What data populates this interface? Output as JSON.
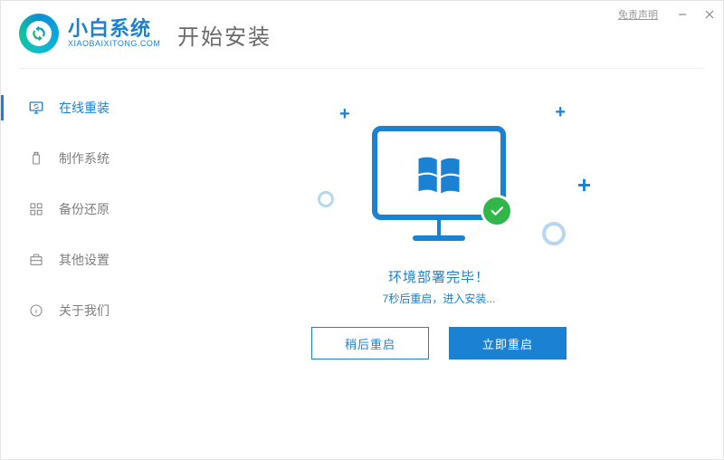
{
  "titlebar": {
    "disclaimer": "免责声明"
  },
  "brand": {
    "title": "小白系统",
    "sub": "XIAOBAIXITONG.COM"
  },
  "page_title": "开始安装",
  "sidebar": {
    "items": [
      {
        "label": "在线重装"
      },
      {
        "label": "制作系统"
      },
      {
        "label": "备份还原"
      },
      {
        "label": "其他设置"
      },
      {
        "label": "关于我们"
      }
    ]
  },
  "main": {
    "status": "环境部署完毕！",
    "sub_status": "7秒后重启，进入安装...",
    "buttons": {
      "later": "稍后重启",
      "now": "立即重启"
    }
  },
  "colors": {
    "accent": "#1b81d2",
    "success": "#2fb74a"
  }
}
